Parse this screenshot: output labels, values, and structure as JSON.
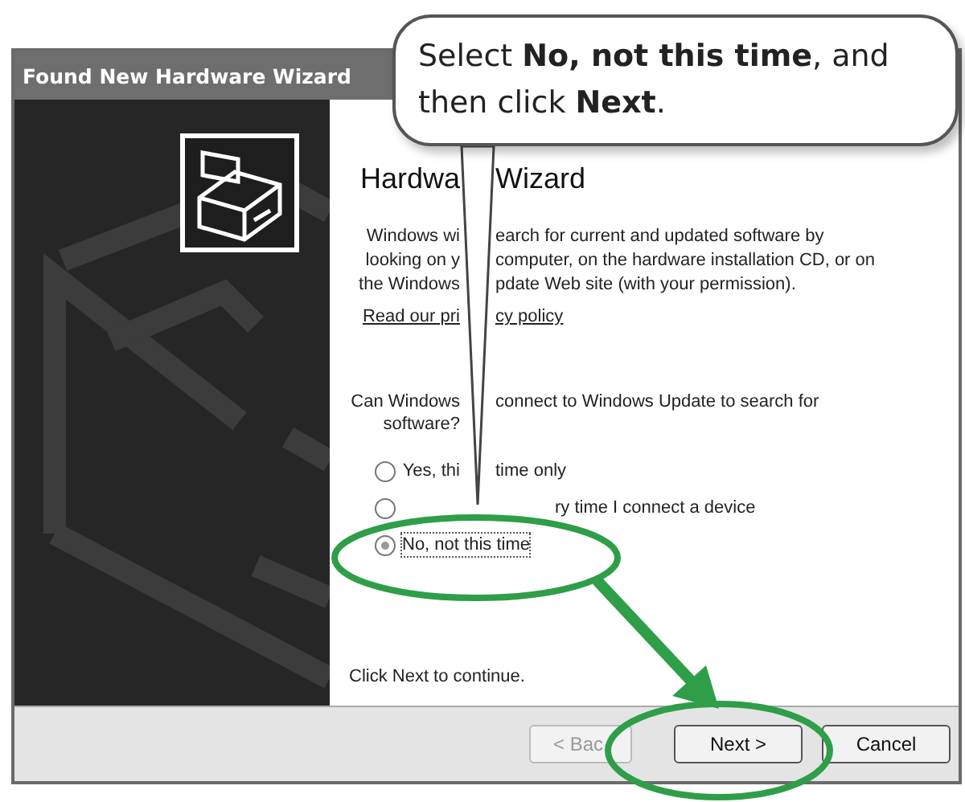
{
  "window": {
    "title": "Found New Hardware Wizard"
  },
  "heading_parts": [
    "Hardwa",
    "Wizard"
  ],
  "intro_lines": [
    [
      "Windows wi",
      "earch for current and updated software by"
    ],
    [
      "looking on y",
      "computer, on the hardware installation CD, or on"
    ],
    [
      "the Windows",
      "pdate Web site (with your permission)."
    ]
  ],
  "privacy_link_parts": [
    "Read our pri",
    "cy policy"
  ],
  "question_lines": [
    [
      "Can Windows",
      "connect to Windows Update to search for"
    ],
    [
      "software?"
    ]
  ],
  "options": [
    {
      "kind": "split",
      "label_parts": [
        "Yes, thi",
        "time only"
      ],
      "selected": false
    },
    {
      "kind": "tail",
      "label_parts": [
        "ry time I connect a device"
      ],
      "selected": false
    },
    {
      "kind": "whole",
      "label_parts": [
        "No, not this time"
      ],
      "selected": true
    }
  ],
  "footer_hint": "Click Next to continue.",
  "buttons": [
    {
      "label": "< Bac",
      "disabled": true
    },
    {
      "label": "Next >",
      "disabled": false
    },
    {
      "label": "Cancel",
      "disabled": false
    }
  ],
  "callout": {
    "text": "Select **No, not this time**, and then click **Next**."
  }
}
